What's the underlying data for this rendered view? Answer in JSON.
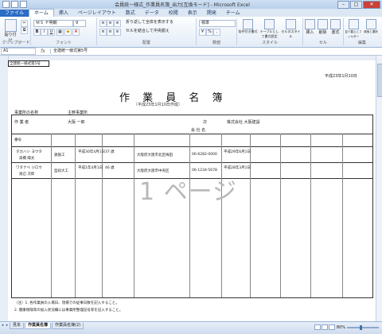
{
  "window": {
    "title": "会員統一様式_作業員名簿_出力[互換モード] - Microsoft Excel"
  },
  "tabs": [
    "ファイル",
    "ホーム",
    "挿入",
    "ページレイアウト",
    "数式",
    "データ",
    "校閲",
    "表示",
    "開発",
    "チーム"
  ],
  "ribbon": {
    "paste": "貼り付け",
    "clipboard_label": "クリップボード",
    "font_name": "ＭＳ Ｐ明朝",
    "font_size": "9",
    "font_label": "フォント",
    "align_label": "配置",
    "wrap_text": "折り返して全体を表示する",
    "merge_center": "セルを結合して中央揃え",
    "number_format": "標準",
    "number_label": "数値",
    "cond_format": "条件付き書式",
    "table_format": "テーブルとして書式設定",
    "cell_style": "セルのスタイル",
    "style_label": "スタイル",
    "insert": "挿入",
    "delete": "削除",
    "format": "書式",
    "cells_label": "セル",
    "sort_filter": "並べ替えとフィルター",
    "find_select": "検索と選択",
    "edit_label": "編集"
  },
  "formula_bar": {
    "name_box": "A1",
    "fx": "fx",
    "content": "全建統一様式第5号"
  },
  "sheet": {
    "a1": "全建統一様式第5号",
    "title": "作 業 員 名 簿",
    "subtitle": "（平成23年1月10日作成）",
    "date": "平成23年1月10日",
    "office_label": "事業所の名称",
    "office_value": "主幹事業所",
    "manager_label": "作 業 者",
    "manager_value": "大阪 一郎",
    "company_label": "会 社 名",
    "company_value": "株式会社 大阪建設",
    "contractor_note": "次",
    "num_label": "番号",
    "row1_name": "タカハシ ヨウタ",
    "row1_kanji": "高橋 陽太",
    "row1_job": "鉄筋工",
    "row1_birth": "平成30年4月1日",
    "row1_age": "37 歳",
    "row1_addr": "大阪府大阪市北区梅田",
    "row1_tel": "06-6282-0000",
    "row1_date": "平成29年6月1日",
    "row2_name": "ワタナベ ジロウ",
    "row2_kanji": "渡辺 次郎",
    "row2_job": "型枠大工",
    "row2_birth": "平成1年4月1日",
    "row2_age": "46 歳",
    "row2_addr": "大阪府大阪市中央区",
    "row2_tel": "06-1234-5678",
    "row2_date": "平成28年3月1日",
    "watermark": "1 ページ",
    "note1": "（注）1. 各作業員の入場日、現場での従事日数を記入すること。",
    "note2": "2. 健康保険等の加入状況欄には事業所整理記号等を記入すること。"
  },
  "status": {
    "sheet_tabs": [
      "見本",
      "作業員名簿",
      "作業員名簿(2)"
    ],
    "zoom": "80%"
  },
  "colors": {
    "file_tab": "#2b6cc4",
    "close": "#c9413a",
    "accent": "#456fae"
  }
}
